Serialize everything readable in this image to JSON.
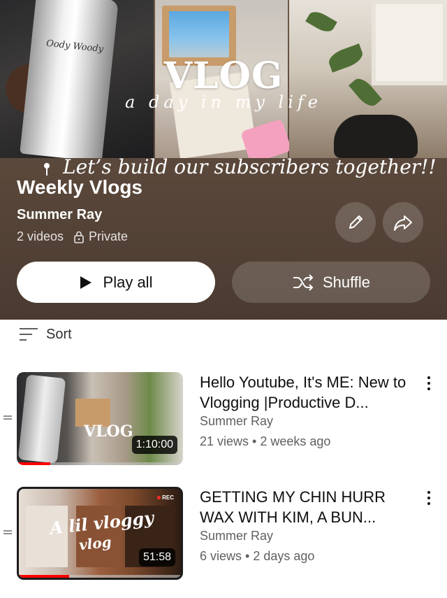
{
  "banner": {
    "vlog_title": "VLOG",
    "vlog_subtitle": "a day in my life",
    "tagline": "Let’s build our subscribers together!!",
    "can_text": "Oody Woody"
  },
  "playlist": {
    "title": "Weekly Vlogs",
    "owner": "Summer Ray",
    "video_count": "2 videos",
    "privacy": "Private"
  },
  "actions": {
    "play_all": "Play all",
    "shuffle": "Shuffle"
  },
  "sort": {
    "label": "Sort"
  },
  "videos": [
    {
      "title": "Hello Youtube, It's ME: New to Vlogging |Productive D...",
      "owner": "Summer Ray",
      "views": "21 views",
      "age": "2 weeks ago",
      "duration": "1:10:00",
      "thumb_text": "VLOG",
      "progress": 0.2
    },
    {
      "title": "GETTING MY CHIN HURR WAX WITH KIM, A BUN...",
      "owner": "Summer Ray",
      "views": "6 views",
      "age": "2 days ago",
      "duration": "51:58",
      "thumb_text": "A lil vloggy",
      "thumb_text_2": "vlog",
      "rec_label": "REC",
      "progress": 0.31
    }
  ],
  "colors": {
    "header_bg": "#5d4a3d",
    "progress_red": "#ff0000",
    "secondary_text": "#606060"
  }
}
